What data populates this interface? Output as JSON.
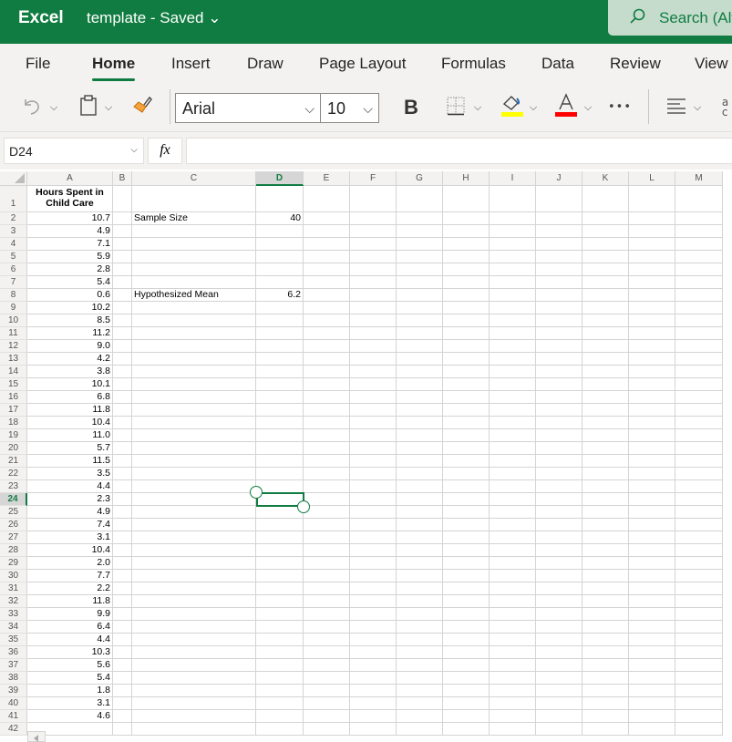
{
  "titlebar": {
    "app_name": "Excel",
    "doc_title": "template - Saved ⌄",
    "search_placeholder": "Search (Alt"
  },
  "tabs": [
    {
      "label": "File",
      "active": false
    },
    {
      "label": "Home",
      "active": true
    },
    {
      "label": "Insert",
      "active": false
    },
    {
      "label": "Draw",
      "active": false
    },
    {
      "label": "Page Layout",
      "active": false
    },
    {
      "label": "Formulas",
      "active": false
    },
    {
      "label": "Data",
      "active": false
    },
    {
      "label": "Review",
      "active": false
    },
    {
      "label": "View",
      "active": false
    }
  ],
  "ribbon": {
    "font_name": "Arial",
    "font_size": "10",
    "bold_label": "B",
    "more_label": "•••",
    "fill_color": "#ffff00",
    "font_color": "#ff0000"
  },
  "formula_bar": {
    "name_box": "D24",
    "fx_label": "fx",
    "formula": ""
  },
  "sheet": {
    "columns": [
      "A",
      "B",
      "C",
      "D",
      "E",
      "F",
      "G",
      "H",
      "I",
      "J",
      "K",
      "L",
      "M"
    ],
    "selected_column": "D",
    "selected_row": 24,
    "active_cell": "D24",
    "header_A1": "Hours Spent in Child Care",
    "column_A_values": [
      "10.7",
      "4.9",
      "7.1",
      "5.9",
      "2.8",
      "5.4",
      "0.6",
      "10.2",
      "8.5",
      "11.2",
      "9.0",
      "4.2",
      "3.8",
      "10.1",
      "6.8",
      "11.8",
      "10.4",
      "11.0",
      "5.7",
      "11.5",
      "3.5",
      "4.4",
      "2.3",
      "4.9",
      "7.4",
      "3.1",
      "10.4",
      "2.0",
      "7.7",
      "2.2",
      "11.8",
      "9.9",
      "6.4",
      "4.4",
      "10.3",
      "5.6",
      "5.4",
      "1.8",
      "3.1",
      "4.6"
    ],
    "labels": [
      {
        "row": 2,
        "label": "Sample Size",
        "value": "40"
      },
      {
        "row": 8,
        "label": "Hypothesized Mean",
        "value": "6.2"
      }
    ],
    "row_count_visible": 42
  },
  "colors": {
    "brand": "#107c41",
    "search_bg": "#c5dccd"
  }
}
